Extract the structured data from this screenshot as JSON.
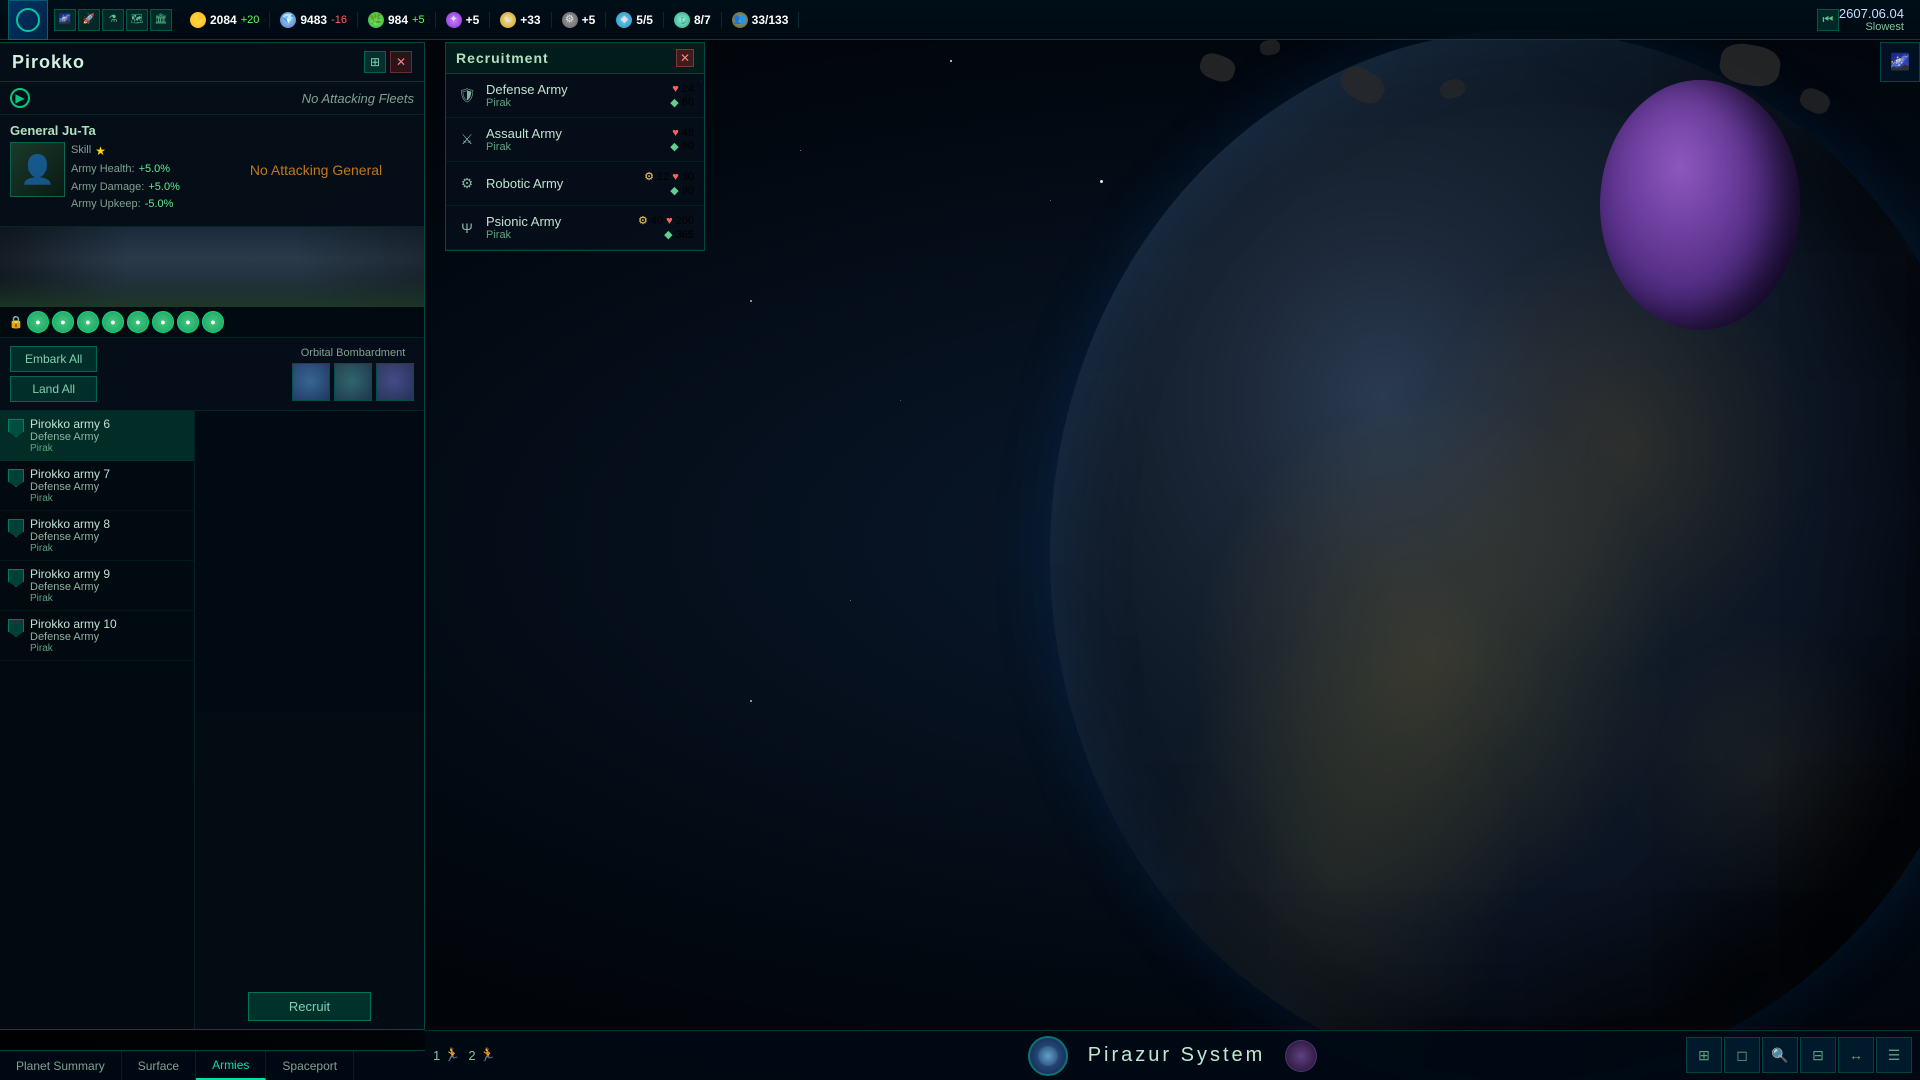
{
  "game": {
    "date": "2607.06.04",
    "speed": "Slowest"
  },
  "topbar": {
    "energy": {
      "value": "2084",
      "delta": "+20",
      "label": "Energy"
    },
    "minerals": {
      "value": "9483",
      "delta": "-16",
      "label": "Minerals"
    },
    "food": {
      "value": "984",
      "delta": "+5",
      "label": "Food"
    },
    "influence": {
      "value": "+5",
      "label": "Influence"
    },
    "unity": {
      "value": "+33",
      "label": "Unity"
    },
    "alloys": {
      "value": "+5",
      "label": "Alloys"
    },
    "consumer_goods": {
      "value": "5/5",
      "label": "Consumer Goods"
    },
    "naval": {
      "value": "8/7",
      "label": "Naval Capacity"
    },
    "pop": {
      "value": "33/133",
      "label": "Pop"
    }
  },
  "planet": {
    "name": "Pirokko",
    "system": "Pirazur System"
  },
  "fleet_section": {
    "no_fleet_label": "No Attacking Fleets",
    "arrow_symbol": "▶"
  },
  "general": {
    "name": "General Ju-Ta",
    "skill_label": "Skill",
    "skill_stars": "★",
    "stats": {
      "health_label": "Army Health:",
      "health_val": "+5.0%",
      "damage_label": "Army Damage:",
      "damage_val": "+5.0%",
      "upkeep_label": "Army Upkeep:",
      "upkeep_val": "-5.0%"
    },
    "no_general_label": "No Attacking General"
  },
  "action_buttons": {
    "embark_all": "Embark All",
    "land_all": "Land All",
    "orbital_label": "Orbital Bombardment"
  },
  "armies": [
    {
      "id": 1,
      "name": "Pirokko army 6",
      "type": "Defense Army",
      "owner": "Pirak"
    },
    {
      "id": 2,
      "name": "Pirokko army 7",
      "type": "Defense Army",
      "owner": "Pirak"
    },
    {
      "id": 3,
      "name": "Pirokko army 8",
      "type": "Defense Army",
      "owner": "Pirak"
    },
    {
      "id": 4,
      "name": "Pirokko army 9",
      "type": "Defense Army",
      "owner": "Pirak"
    },
    {
      "id": 5,
      "name": "Pirokko army 10",
      "type": "Defense Army",
      "owner": "Pirak"
    }
  ],
  "recruit_button": "Recruit",
  "tabs": {
    "items": [
      {
        "id": "planet-summary",
        "label": "Planet Summary"
      },
      {
        "id": "surface",
        "label": "Surface"
      },
      {
        "id": "armies",
        "label": "Armies"
      },
      {
        "id": "spaceport",
        "label": "Spaceport"
      }
    ]
  },
  "recruitment": {
    "title": "Recruitment",
    "close_symbol": "✕",
    "armies": [
      {
        "name": "Defense Army",
        "owner": "Pirak",
        "icon": "🛡",
        "cost_heart": "24",
        "cost_mineral": "60"
      },
      {
        "name": "Assault Army",
        "owner": "Pirak",
        "icon": "⚔",
        "cost_heart": "48",
        "cost_mineral": "90"
      },
      {
        "name": "Robotic Army",
        "owner": "",
        "icon": "🤖",
        "cost_alloy": "12",
        "cost_heart": "80",
        "cost_mineral": "90"
      },
      {
        "name": "Psionic Army",
        "owner": "Pirak",
        "icon": "🔮",
        "cost_alloy": "40",
        "cost_heart": "200",
        "cost_mineral": "365"
      }
    ]
  },
  "bottom_toolbar": {
    "buttons": [
      "⊞",
      "◻",
      "🔍",
      "⊟",
      "↔",
      "☰"
    ]
  },
  "bottom_indicators": [
    {
      "value": "1",
      "icon": "🏃"
    },
    {
      "value": "2",
      "icon": "🏃"
    }
  ]
}
